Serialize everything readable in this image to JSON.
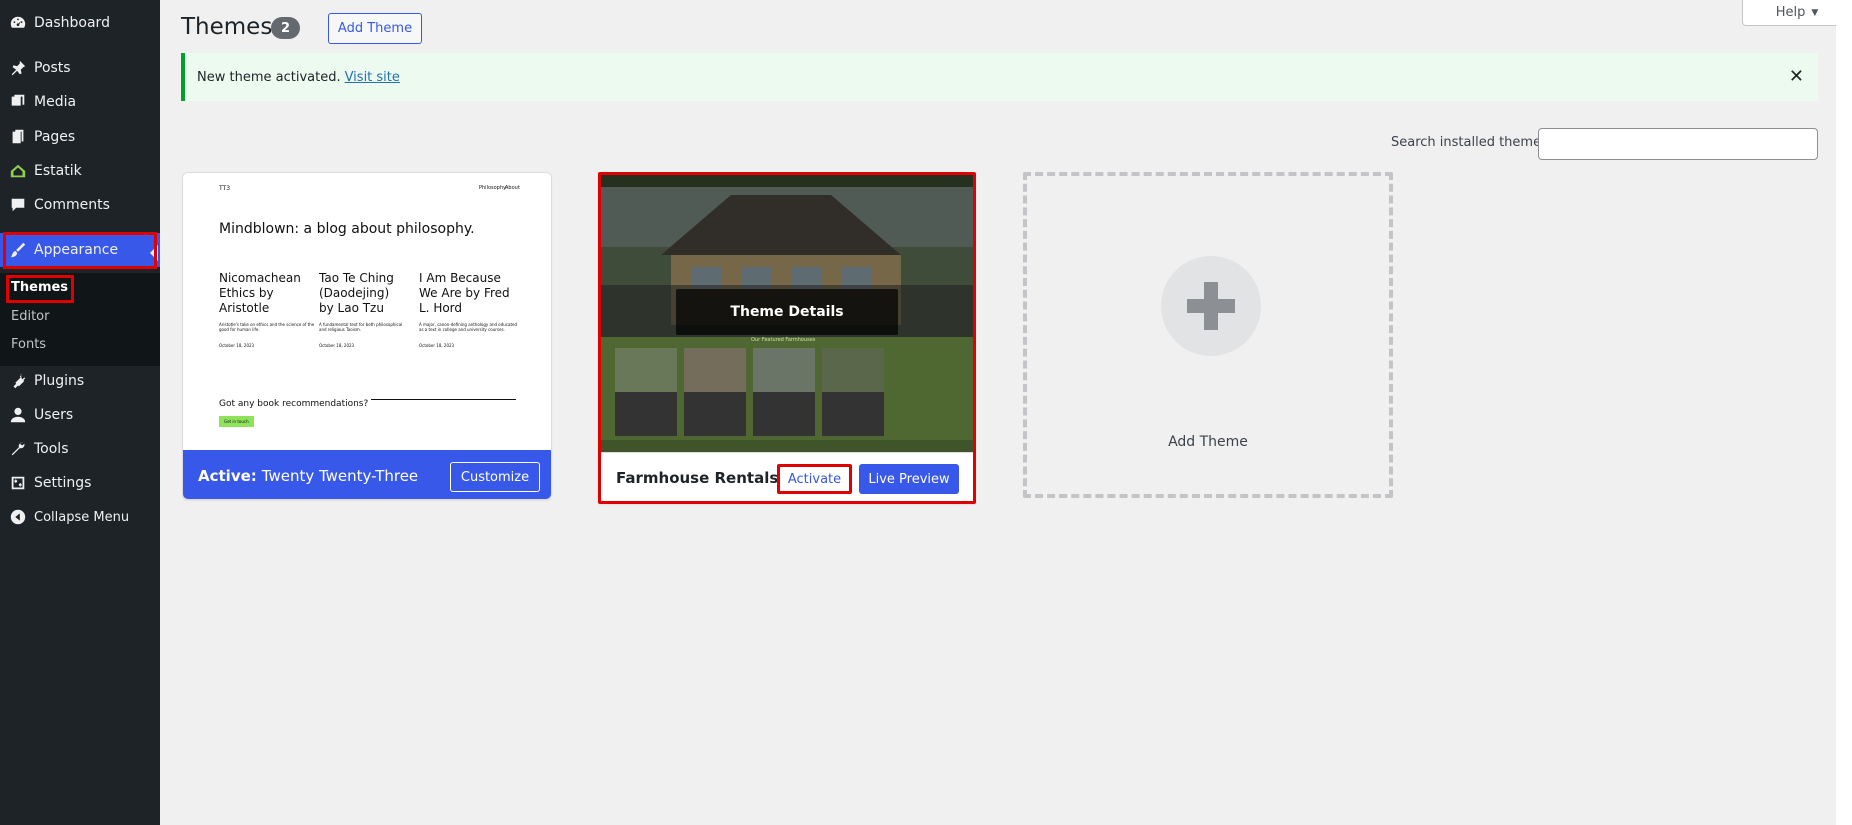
{
  "sidebar": {
    "items": [
      {
        "label": "Dashboard",
        "icon": "dashboard-icon"
      },
      {
        "label": "Posts",
        "icon": "pin-icon"
      },
      {
        "label": "Media",
        "icon": "media-icon"
      },
      {
        "label": "Pages",
        "icon": "pages-icon"
      },
      {
        "label": "Estatik",
        "icon": "house-icon"
      },
      {
        "label": "Comments",
        "icon": "comment-icon"
      },
      {
        "label": "Appearance",
        "icon": "brush-icon"
      },
      {
        "label": "Plugins",
        "icon": "plug-icon"
      },
      {
        "label": "Users",
        "icon": "user-icon"
      },
      {
        "label": "Tools",
        "icon": "wrench-icon"
      },
      {
        "label": "Settings",
        "icon": "settings-icon"
      },
      {
        "label": "Collapse Menu",
        "icon": "collapse-icon"
      }
    ],
    "submenu": [
      "Themes",
      "Editor",
      "Fonts"
    ]
  },
  "header": {
    "title": "Themes",
    "count": "2",
    "add_button": "Add Theme",
    "help": "Help"
  },
  "notice": {
    "text": "New theme activated.",
    "link": "Visit site",
    "close": "✕"
  },
  "search": {
    "label": "Search installed themes",
    "value": ""
  },
  "themes": {
    "active": {
      "prefix": "Active:",
      "name": "Twenty Twenty-Three",
      "customize": "Customize",
      "preview": {
        "logo": "TT3",
        "nav": [
          "Philosophy",
          "About"
        ],
        "headline": "Mindblown: a blog about philosophy.",
        "posts": [
          {
            "title": "Nicomachean Ethics by Aristotle",
            "excerpt": "Aristotle's take on ethics and the science of the good for human life.",
            "date": "October 18, 2023"
          },
          {
            "title": "Tao Te Ching (Daodejing) by Lao Tzu",
            "excerpt": "A fundamental text for both philosophical and religious Taoism.",
            "date": "October 18, 2023"
          },
          {
            "title": "I Am Because We Are by Fred L. Hord",
            "excerpt": "A major, canon-defining anthology and educated as a text in college and university courses.",
            "date": "October 18, 2023"
          }
        ],
        "cta": "Got any book recommendations?",
        "cta_button": "Get in touch"
      }
    },
    "second": {
      "name": "Farmhouse Rentals",
      "activate": "Activate",
      "live_preview": "Live Preview",
      "details": "Theme Details",
      "preview_heading": "Our Featured Farmhouses"
    },
    "add": {
      "label": "Add Theme"
    }
  },
  "colors": {
    "accent": "#3858e9",
    "sidebar_bg": "#1d2327",
    "highlight": "#e00000",
    "notice_green": "#00a32a"
  }
}
